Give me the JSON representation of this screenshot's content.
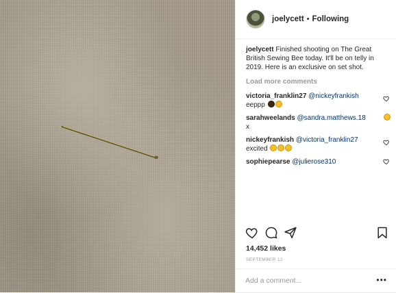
{
  "post": {
    "username": "joelycett",
    "separator": "•",
    "follow_status": "Following",
    "caption_text": "Finished shooting on The Great British Sewing Bee today. It'll be on telly in 2019. Here is an exclusive on set shot.",
    "load_more_label": "Load more comments",
    "likes_text": "14,452 likes",
    "date_text": "SEPTEMBER 12",
    "add_comment_placeholder": "Add a comment...",
    "more_options": "•••"
  },
  "comments": [
    {
      "username": "victoria_franklin27",
      "mention": "@nickeyfrankish",
      "text": "eeppp",
      "emoji": [
        "dark-emoji",
        "laughing-emoji"
      ]
    },
    {
      "username": "sarahweelands",
      "mention": "@sandra.matthews.18",
      "text": "x",
      "emoji": [
        "laughing-emoji"
      ]
    },
    {
      "username": "nickeyfrankish",
      "mention": "@victoria_franklin27",
      "text": "excited",
      "emoji": [
        "laughing-emoji",
        "laughing-emoji",
        "laughing-emoji"
      ]
    },
    {
      "username": "sophiepearse",
      "mention": "@julierose310",
      "text": ""
    }
  ],
  "icons": {
    "like": "heart-icon",
    "comment": "comment-icon",
    "share": "share-icon",
    "save": "bookmark-icon"
  },
  "colors": {
    "mention": "#003569",
    "muted": "#999999",
    "text": "#262626",
    "photo_fabric": "#a59c89",
    "needle": "#b8a160"
  }
}
